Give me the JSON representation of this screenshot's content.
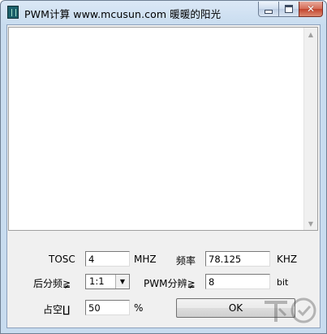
{
  "window": {
    "title": "PWM计算 www.mcusun.com  暖暖的阳光"
  },
  "output": {
    "text": ""
  },
  "form": {
    "tosc_label": "TOSC",
    "tosc_value": "4",
    "tosc_unit": "MHZ",
    "freq_label": "频率",
    "freq_value": "78.125",
    "freq_unit": "KHZ",
    "divider_label": "后分频≩",
    "divider_value": "1:1",
    "pwm_res_label": "PWM分辨≩",
    "pwm_res_value": "8",
    "pwm_res_unit": "bit",
    "duty_label": "占空∐",
    "duty_value": "50",
    "duty_unit": "%",
    "ok_label": "OK"
  },
  "icons": {
    "app": "pwm-app-icon",
    "minimize": "minimize-icon",
    "maximize": "maximize-icon",
    "close": "close-icon",
    "watermark": "xiazai-watermark-logo"
  }
}
